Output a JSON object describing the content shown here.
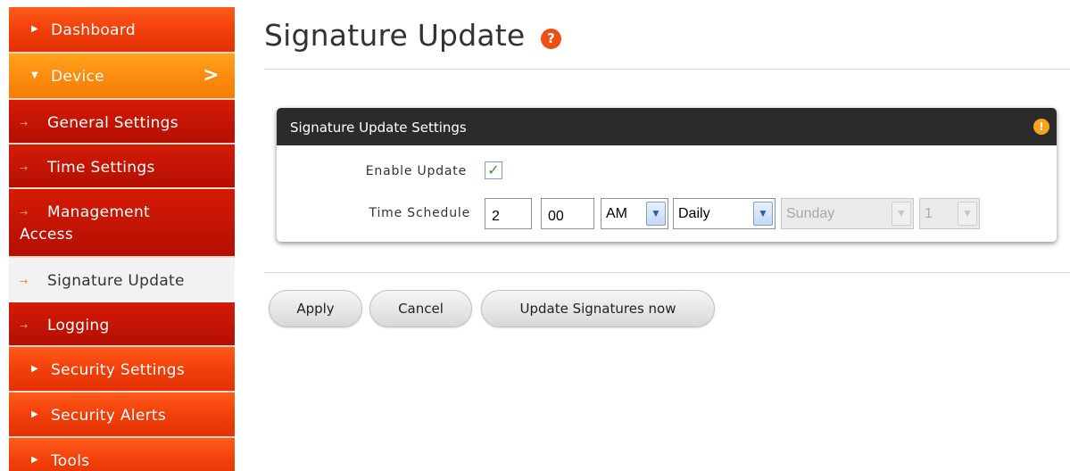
{
  "sidebar": {
    "items": [
      {
        "label": "Dashboard",
        "icon": "triangle-right-icon"
      },
      {
        "label": "Device",
        "icon": "triangle-down-icon",
        "chevron": ">"
      },
      {
        "label": "General Settings",
        "icon": "small-arrow-icon"
      },
      {
        "label": "Time Settings",
        "icon": "small-arrow-icon"
      },
      {
        "label_line1": "Management",
        "label_line2": "Access",
        "icon": "small-arrow-icon"
      },
      {
        "label": "Signature Update",
        "icon": "small-arrow-icon"
      },
      {
        "label": "Logging",
        "icon": "small-arrow-icon"
      },
      {
        "label": "Security Settings",
        "icon": "triangle-right-icon"
      },
      {
        "label": "Security Alerts",
        "icon": "triangle-right-icon"
      },
      {
        "label": "Tools",
        "icon": "triangle-right-icon"
      }
    ]
  },
  "page": {
    "title": "Signature Update",
    "help_icon": "?"
  },
  "panel": {
    "title": "Signature Update Settings",
    "info_icon": "!",
    "enable_update_label": "Enable Update",
    "enable_update_checked": true,
    "time_schedule_label": "Time Schedule",
    "hour": "2",
    "minute": "00",
    "ampm": "AM",
    "frequency": "Daily",
    "day": "Sunday",
    "day_of_month": "1"
  },
  "buttons": {
    "apply": "Apply",
    "cancel": "Cancel",
    "update_now": "Update Signatures now"
  },
  "colors": {
    "nav_red": "#e23204",
    "nav_orange": "#f47e05",
    "sub_red": "#b40f02",
    "panel_header": "#2b2b2b",
    "accent": "#ef4f12"
  }
}
